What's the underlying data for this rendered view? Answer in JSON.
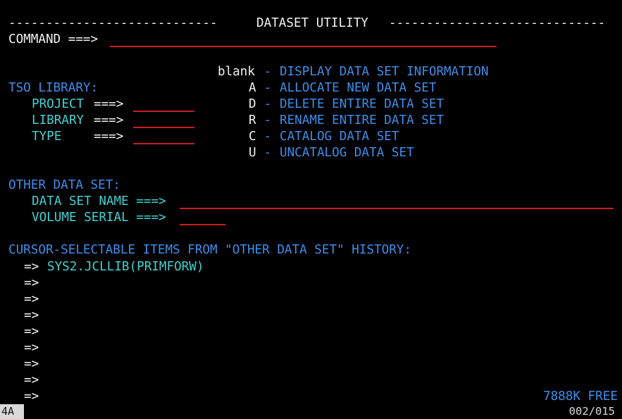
{
  "screen": {
    "header_left_dashes": "----------------------------",
    "title": "DATASET UTILITY",
    "header_right_dashes": "-----------------------------"
  },
  "command": {
    "label": "COMMAND ===>",
    "value": ""
  },
  "options": [
    {
      "code": "blank",
      "sep": " - ",
      "desc": "DISPLAY DATA SET INFORMATION"
    },
    {
      "code": "A",
      "sep": " - ",
      "desc": "ALLOCATE NEW DATA SET"
    },
    {
      "code": "D",
      "sep": " - ",
      "desc": "DELETE ENTIRE DATA SET"
    },
    {
      "code": "R",
      "sep": " - ",
      "desc": "RENAME ENTIRE DATA SET"
    },
    {
      "code": "C",
      "sep": " - ",
      "desc": "CATALOG DATA SET"
    },
    {
      "code": "U",
      "sep": " - ",
      "desc": "UNCATALOG DATA SET"
    }
  ],
  "tso_library": {
    "heading": "TSO LIBRARY:",
    "project_label": "PROJECT",
    "library_label": "LIBRARY",
    "type_label": "TYPE",
    "arrow": "===>",
    "project_value": "",
    "library_value": "",
    "type_value": ""
  },
  "other_data_set": {
    "heading": "OTHER DATA SET:",
    "dsn_label": "DATA SET NAME ===>",
    "volser_label": "VOLUME SERIAL ===>",
    "dsn_value": "",
    "volser_value": ""
  },
  "history": {
    "heading": "CURSOR-SELECTABLE ITEMS FROM \"OTHER DATA SET\" HISTORY:",
    "arrow": "=>",
    "items": [
      "SYS2.JCLLIB(PRIMFORW)",
      "",
      "",
      "",
      "",
      "",
      "",
      "",
      ""
    ]
  },
  "status": {
    "free_storage": "7888K FREE",
    "session_indicator": "4A",
    "cursor_position": "002/015"
  },
  "colors": {
    "background": "#000000",
    "text_white": "#f2f2f2",
    "text_blue": "#3b8eea",
    "text_cyan": "#3fd2d2",
    "field_underline": "#c81e1e"
  }
}
